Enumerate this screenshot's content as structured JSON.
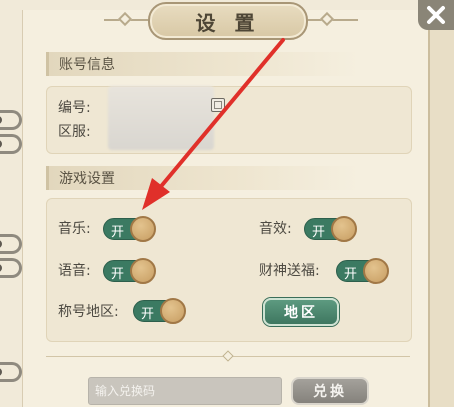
{
  "header": {
    "title": "设 置"
  },
  "account": {
    "section_title": "账号信息",
    "id_label": "编号:",
    "server_label": "区服:"
  },
  "game": {
    "section_title": "游戏设置",
    "toggles": [
      {
        "label": "音乐:",
        "state_text": "开",
        "on": true
      },
      {
        "label": "音效:",
        "state_text": "开",
        "on": true
      },
      {
        "label": "语音:",
        "state_text": "开",
        "on": true
      },
      {
        "label": "财神送福:",
        "state_text": "开",
        "on": true
      },
      {
        "label": "称号地区:",
        "state_text": "开",
        "on": true
      }
    ],
    "region_button": "地区"
  },
  "redeem": {
    "placeholder": "输入兑换码",
    "button": "兑换"
  },
  "icons": {
    "close": "close-icon",
    "copy": "copy-icon",
    "annotation_arrow": "red-arrow"
  },
  "colors": {
    "toggle_on": "#3b7a62",
    "knob": "#c79d62",
    "arrow": "#e0302a"
  }
}
